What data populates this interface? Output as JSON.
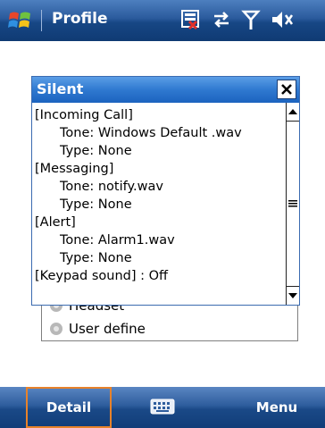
{
  "titlebar": {
    "title": "Profile",
    "icons": [
      "windows-start-icon",
      "sim-status-icon",
      "connectivity-icon",
      "signal-icon",
      "volume-muted-icon"
    ]
  },
  "popup": {
    "title": "Silent",
    "lines": [
      "[Incoming Call]",
      "Tone: Windows Default .wav",
      "Type: None",
      "[Messaging]",
      "Tone: notify.wav",
      "Type: None",
      "[Alert]",
      "Tone: Alarm1.wav",
      "Type: None",
      "[Keypad sound] : Off"
    ]
  },
  "background_list": {
    "items": [
      "Headset",
      "User define"
    ]
  },
  "softkeys": {
    "left": "Detail",
    "right": "Menu"
  },
  "colors": {
    "titlebar": "#174785",
    "popup_header": "#2f79d0",
    "focus_outline": "#e8822a"
  }
}
